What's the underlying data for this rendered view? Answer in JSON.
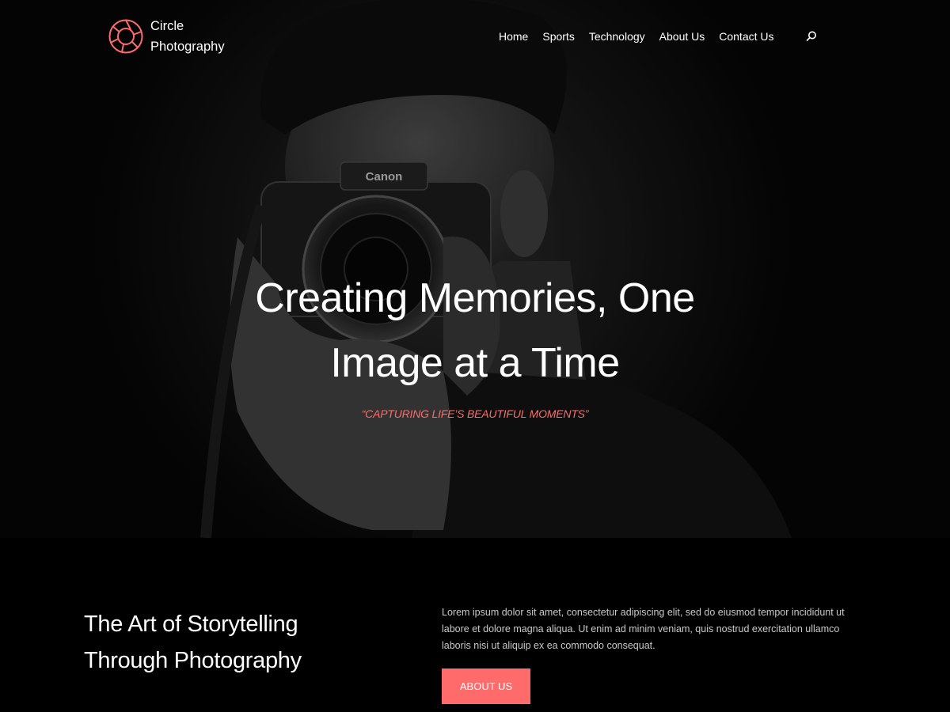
{
  "brand": {
    "name": "Circle Photography",
    "accent_color": "#ff6b6b",
    "logo_icon": "circle-aperture-icon"
  },
  "nav": {
    "items": [
      {
        "label": "Home"
      },
      {
        "label": "Sports"
      },
      {
        "label": "Technology"
      },
      {
        "label": "About Us"
      },
      {
        "label": "Contact Us"
      }
    ],
    "search_icon": "search-icon"
  },
  "hero": {
    "title": "Creating Memories, One Image at a Time",
    "tagline": "“CAPTURING LIFE’S BEAUTIFUL MOMENTS”",
    "camera_brand": "Canon"
  },
  "about": {
    "heading": "The Art of Storytelling Through Photography",
    "text": "Lorem ipsum dolor sit amet, consectetur adipiscing elit, sed do eiusmod tempor incididunt ut labore et dolore magna aliqua. Ut enim ad minim veniam, quis nostrud exercitation ullamco laboris nisi ut aliquip ex ea commodo consequat.",
    "button_label": "ABOUT US"
  }
}
